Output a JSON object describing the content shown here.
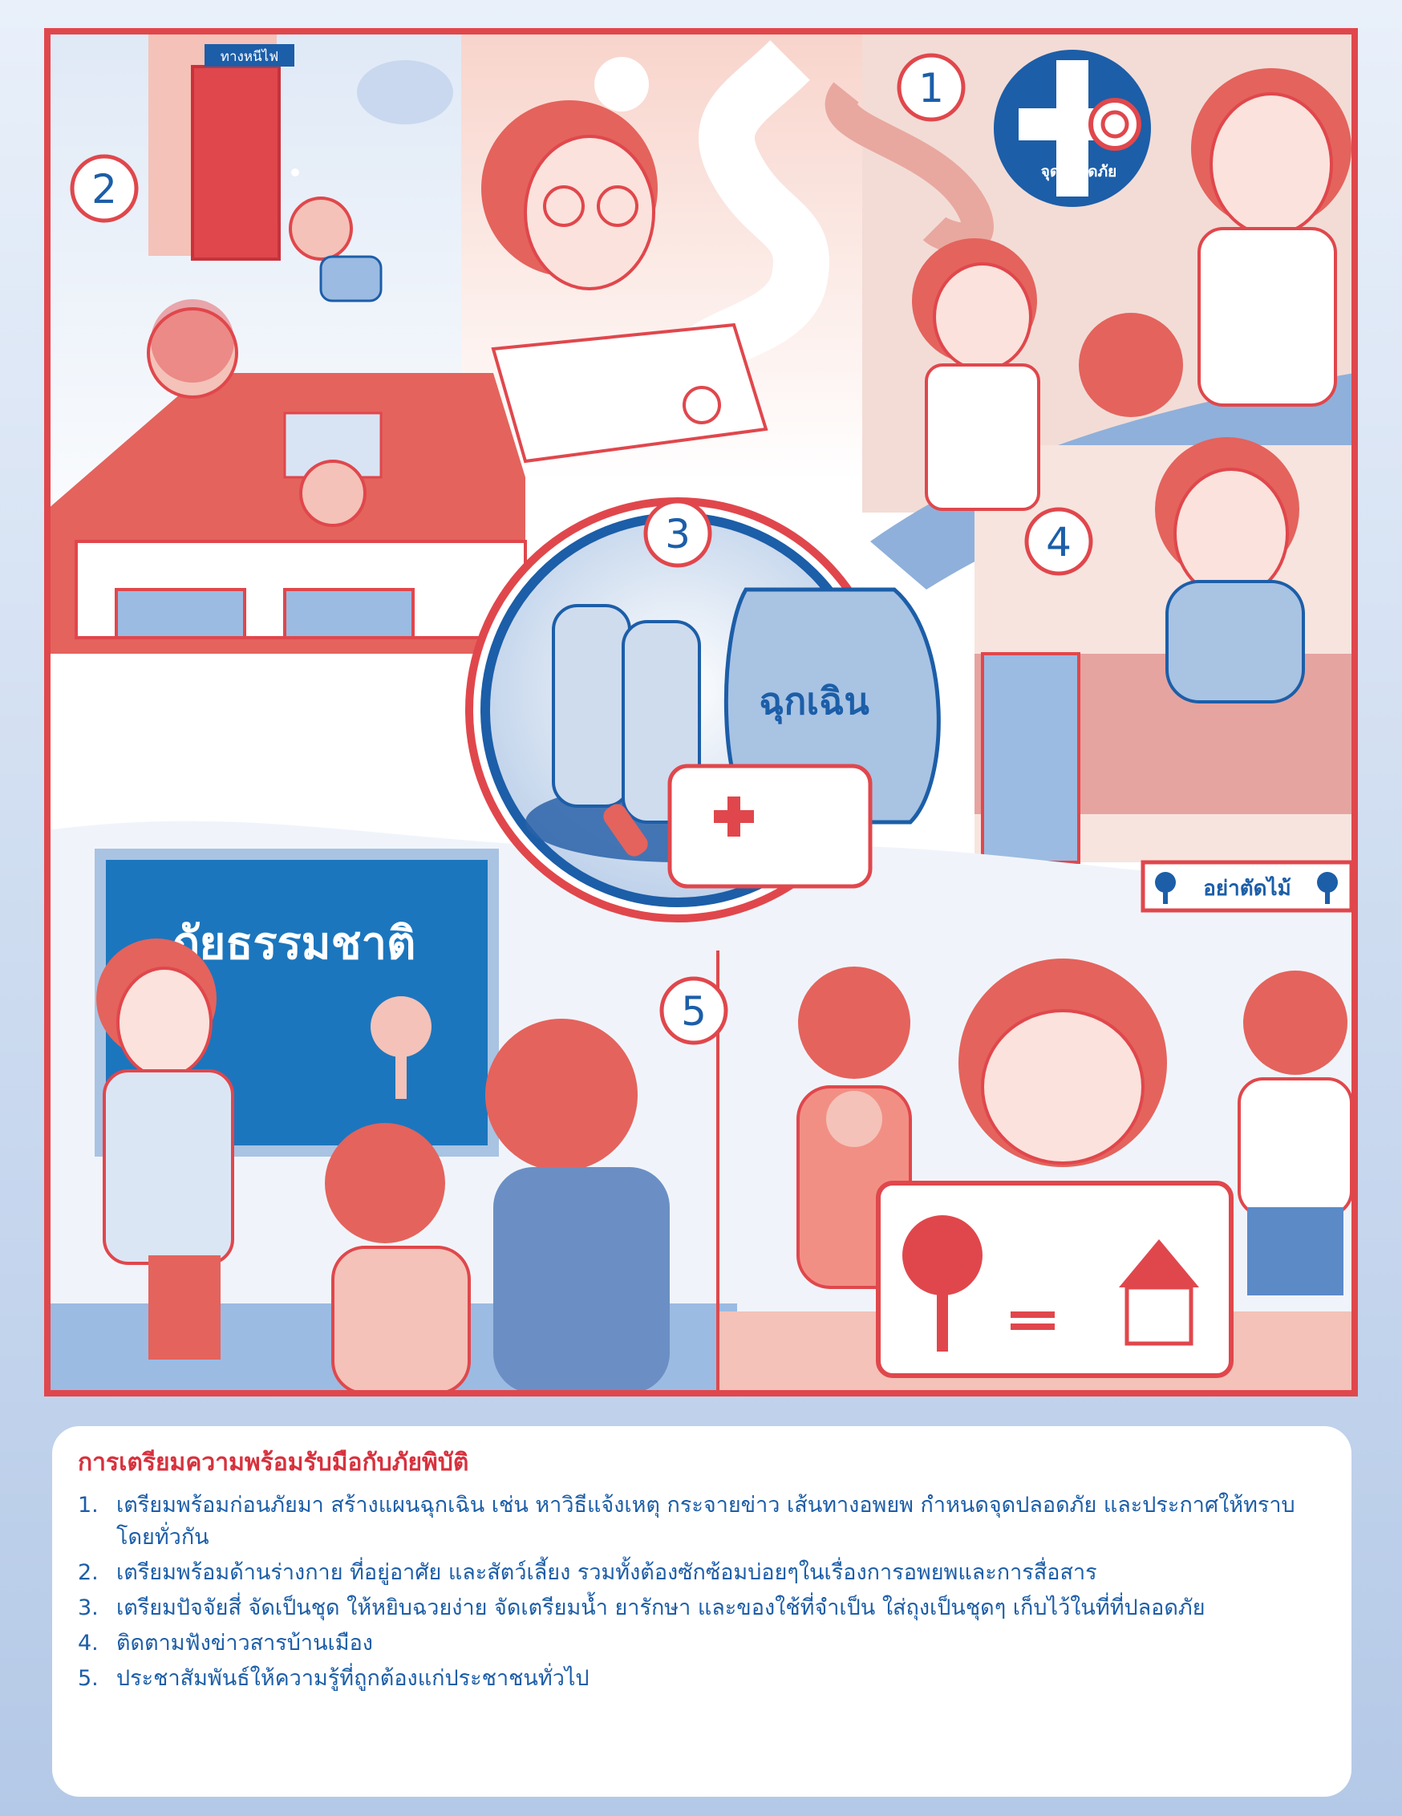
{
  "poster": {
    "exit_sign": "ทางหนีไฟ",
    "safe_point": "จุดปลอดภัย",
    "emergency_bag": "ฉุกเฉิน",
    "blackboard": "ภัยธรรมชาติ",
    "protest_sign": "อย่าตัดไม้",
    "step_numbers": [
      "1",
      "2",
      "3",
      "4",
      "5"
    ]
  },
  "info": {
    "title": "การเตรียมความพร้อมรับมือกับภัยพิบัติ",
    "items": [
      {
        "num": "1.",
        "text": "เตรียมพร้อมก่อนภัยมา สร้างแผนฉุกเฉิน เช่น หาวิธีแจ้งเหตุ กระจายข่าว เส้นทางอพยพ กำหนดจุดปลอดภัย และประกาศให้ทราบโดยทั่วกัน"
      },
      {
        "num": "2.",
        "text": "เตรียมพร้อมด้านร่างกาย ที่อยู่อาศัย และสัตว์เลี้ยง รวมทั้งต้องซักซ้อมบ่อยๆในเรื่องการอพยพและการสื่อสาร"
      },
      {
        "num": "3.",
        "text": "เตรียมปัจจัยสี่ จัดเป็นชุด ให้หยิบฉวยง่าย จัดเตรียมน้ำ ยารักษา และของใช้ที่จำเป็น ใส่ถุงเป็นชุดๆ เก็บไว้ในที่ที่ปลอดภัย"
      },
      {
        "num": "4.",
        "text": "ติดตามฟังข่าวสารบ้านเมือง"
      },
      {
        "num": "5.",
        "text": "ประชาสัมพันธ์ให้ความรู้ที่ถูกต้องแก่ประชาชนทั่วไป"
      }
    ]
  },
  "colors": {
    "red": "#e0474c",
    "blue": "#1c5ea8",
    "light_blue": "#a9c3e3",
    "pink": "#f4c2b8"
  }
}
